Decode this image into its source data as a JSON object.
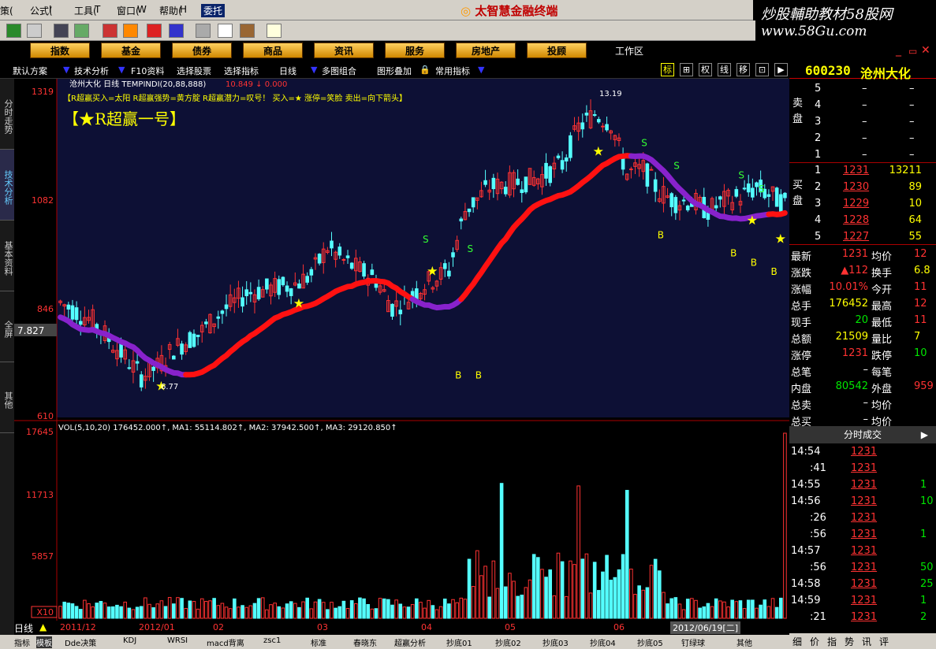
{
  "menu": {
    "items": [
      "策(",
      "公式(",
      "工具(",
      "窗口(",
      "帮助("
    ],
    "menu_keys": [
      "",
      "I",
      "T",
      "W",
      "H"
    ],
    "active": "委托",
    "brand": "太智慧金融终端"
  },
  "watermark": {
    "line1": "炒股輔助教材58股网",
    "line2": "www.58Gu.com"
  },
  "categories": [
    "指数",
    "基金",
    "债券",
    "商品",
    "资讯",
    "服务",
    "房地产",
    "投顾"
  ],
  "workarea": "工作区",
  "subbar": {
    "items": [
      "默认方案",
      "技术分析",
      "F10资料",
      "选择股票",
      "选择指标",
      "日线",
      "多图组合",
      "图形叠加",
      "常用指标"
    ],
    "right_icons": [
      "标",
      "⊞",
      "权",
      "线",
      "移",
      "⊡",
      "▶"
    ]
  },
  "stock": {
    "code": "600230",
    "name": "沧州大化"
  },
  "left_tabs": [
    "分时走势",
    "技术分析",
    "基本资料",
    "全屏",
    "其他"
  ],
  "chart": {
    "header": "沧州大化 日线 TEMPINDI(20,88,888)",
    "header_values": "10.849 ↓  0.000",
    "legend_line": "【R超赢买入=太阳  R超赢强势=黄方腚  R超赢潜力=叹号！ 买入=★ 涨停=笑脸  卖出=向下箭头】",
    "big_title": "【★R超赢一号】",
    "y_labels": [
      "1319",
      "1082",
      "846",
      "610"
    ],
    "cursor_value": "7.827",
    "price_high": "13.19",
    "price_low": "6.77",
    "x_labels": [
      "2011/12",
      "2012/01",
      "02",
      "03",
      "04",
      "05",
      "06"
    ],
    "date_box": "2012/06/19[二]",
    "period_label": "日线",
    "vol_header": "VOL(5,10,20) 176452.000↑, MA1: 55114.802↑, MA2: 37942.500↑, MA3: 29120.850↑",
    "vol_labels": [
      "17645",
      "11713",
      "5857",
      "X10"
    ]
  },
  "chart_data": {
    "type": "candlestick",
    "title": "沧州大化 日线",
    "ylim": [
      6.1,
      13.19
    ],
    "price_max": 13.19,
    "price_min": 6.77,
    "volume_max": 17645
  },
  "orderbook": {
    "sell": [
      {
        "lvl": "5",
        "p": "–",
        "v": "–"
      },
      {
        "lvl": "4",
        "p": "–",
        "v": "–"
      },
      {
        "lvl": "3",
        "p": "–",
        "v": "–"
      },
      {
        "lvl": "2",
        "p": "–",
        "v": "–"
      },
      {
        "lvl": "1",
        "p": "–",
        "v": "–"
      }
    ],
    "buy": [
      {
        "lvl": "1",
        "p": "1231",
        "v": "13211"
      },
      {
        "lvl": "2",
        "p": "1230",
        "v": "89"
      },
      {
        "lvl": "3",
        "p": "1229",
        "v": "10"
      },
      {
        "lvl": "4",
        "p": "1228",
        "v": "64"
      },
      {
        "lvl": "5",
        "p": "1227",
        "v": "55"
      }
    ],
    "sell_label": "卖盘",
    "buy_label": "买盘"
  },
  "quote": [
    {
      "k1": "最新",
      "v1": "1231",
      "k2": "均价",
      "v2": "12"
    },
    {
      "k1": "涨跌",
      "v1": "▲112",
      "k2": "换手",
      "v2": "6.8"
    },
    {
      "k1": "涨幅",
      "v1": "10.01%",
      "k2": "今开",
      "v2": "11"
    },
    {
      "k1": "总手",
      "v1": "176452",
      "k2": "最高",
      "v2": "12"
    },
    {
      "k1": "现手",
      "v1": "20",
      "k2": "最低",
      "v2": "11"
    },
    {
      "k1": "总额",
      "v1": "21509",
      "k2": "量比",
      "v2": "7"
    },
    {
      "k1": "涨停",
      "v1": "1231",
      "k2": "跌停",
      "v2": "10"
    },
    {
      "k1": "总笔",
      "v1": "–",
      "k2": "每笔",
      "v2": ""
    },
    {
      "k1": "内盘",
      "v1": "80542",
      "k2": "外盘",
      "v2": "959"
    },
    {
      "k1": "总卖",
      "v1": "–",
      "k2": "均价",
      "v2": ""
    },
    {
      "k1": "总买",
      "v1": "–",
      "k2": "均价",
      "v2": ""
    }
  ],
  "tick_header": "分时成交",
  "ticks": [
    {
      "t": "14:54",
      "p": "1231",
      "v": ""
    },
    {
      "t": ":41",
      "p": "1231",
      "v": ""
    },
    {
      "t": "14:55",
      "p": "1231",
      "v": "1"
    },
    {
      "t": "14:56",
      "p": "1231",
      "v": "10"
    },
    {
      "t": ":26",
      "p": "1231",
      "v": ""
    },
    {
      "t": ":56",
      "p": "1231",
      "v": "1"
    },
    {
      "t": "14:57",
      "p": "1231",
      "v": ""
    },
    {
      "t": ":56",
      "p": "1231",
      "v": "50"
    },
    {
      "t": "14:58",
      "p": "1231",
      "v": "25"
    },
    {
      "t": "14:59",
      "p": "1231",
      "v": "1"
    },
    {
      "t": ":21",
      "p": "1231",
      "v": "2"
    }
  ],
  "bottom_tabs": [
    "指标",
    "模板",
    "Dde决策",
    "KDJ",
    "WRSI",
    "macd背离",
    "zsc1",
    "标准",
    "春晓东",
    "超赢分析",
    "抄底01",
    "抄底02",
    "抄底03",
    "抄底04",
    "抄底05",
    "钉绿球",
    "其他"
  ],
  "right_bottom_tabs": [
    "细",
    "价",
    "指",
    "势",
    "讯",
    "评"
  ]
}
